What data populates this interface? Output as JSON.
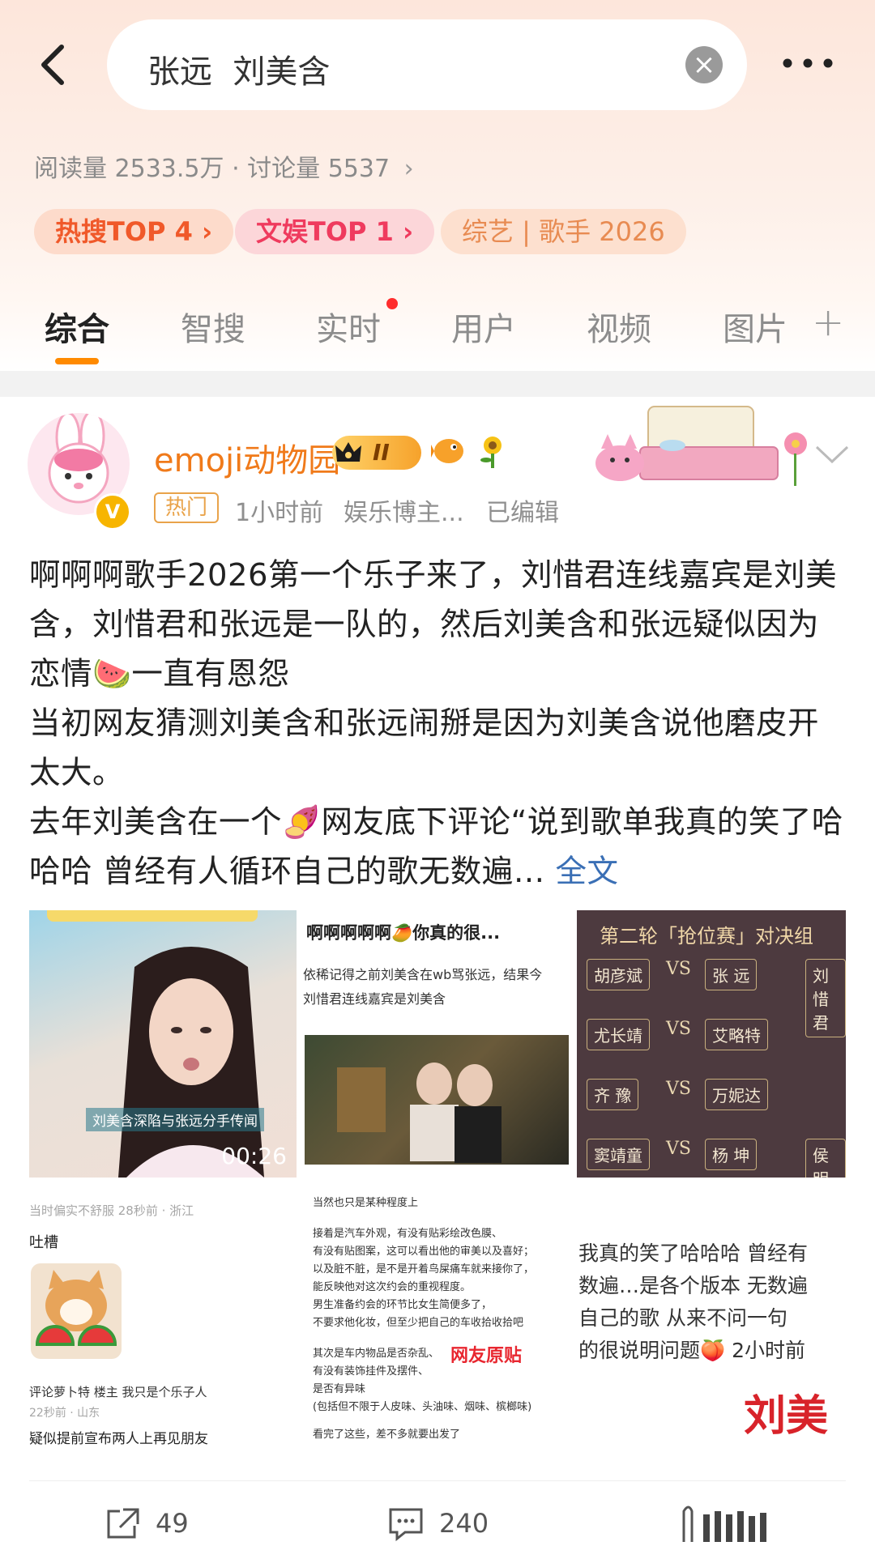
{
  "search": {
    "query": "张远  刘美含"
  },
  "stats": {
    "reads_label": "阅读量",
    "reads": "2533.5万",
    "dot": "·",
    "discuss_label": "讨论量",
    "discuss": "5537"
  },
  "tags": [
    {
      "label": "热搜TOP 4 ›"
    },
    {
      "label": "文娱TOP 1 ›"
    },
    {
      "label": "综艺  |  歌手 2026"
    }
  ],
  "tabs": [
    {
      "label": "综合"
    },
    {
      "label": "智搜"
    },
    {
      "label": "实时"
    },
    {
      "label": "用户"
    },
    {
      "label": "视频"
    },
    {
      "label": "图片"
    }
  ],
  "tab_plus": "+",
  "post": {
    "username": "emoji动物园",
    "vip_level": "II",
    "hot_label": "热门",
    "time": "1小时前",
    "source": "娱乐博主...",
    "edited": "已编辑",
    "paragraphs": [
      "啊啊啊歌手2026第一个乐子来了，刘惜君连线嘉宾是刘美含，刘惜君和张远是一队的，然后刘美含和张远疑似因为恋情🍉一直有恩怨",
      "当初网友猜测刘美含和张远闹掰是因为刘美含说他磨皮开太大。",
      "去年刘美含在一个🍠网友底下评论“说到歌单我真的笑了哈哈哈 曾经有人循环自己的歌无数遍…"
    ],
    "fulltext_label": "全文",
    "images": {
      "t1_caption": "刘美含深陷与张远分手传闻",
      "t1_duration": "00:26",
      "t2_title": "啊啊啊啊啊🥭你真的很...",
      "t2_line1": "依稀记得之前刘美含在wb骂张远，结果今",
      "t2_line2": "刘惜君连线嘉宾是刘美含",
      "t3_title": "第二轮「抢位赛」对决组",
      "t3_pairs": [
        [
          "胡彦斌",
          "VS",
          "张 远",
          "刘惜君"
        ],
        [
          "尤长靖",
          "VS",
          "艾略特",
          ""
        ],
        [
          "齐 豫",
          "VS",
          "万妮达",
          ""
        ],
        [
          "窦靖童",
          "VS",
          "杨 坤",
          "侯明昊"
        ]
      ],
      "t4_top": "当时偏实不舒服  28秒前 · 浙江",
      "t4_label": "吐槽",
      "t4_comment": "评论萝卜特 楼主  我只是个乐子人",
      "t4_time": "22秒前 · 山东",
      "t4_text": "疑似提前宣布两人上再见朋友",
      "t5_lines": [
        "当然也只是某种程度上",
        "接着是汽车外观，有没有贴彩绘改色膜、",
        "有没有贴图案，这可以看出他的审美以及喜好；",
        "以及脏不脏，是不是开着鸟屎痛车就来接你了，",
        "能反映他对这次约会的重视程度。",
        "男生准备约会的环节比女生简便多了，",
        "不要求他化妆，但至少把自己的车收拾收拾吧",
        "其次是车内物品是否杂乱、",
        "有没有装饰挂件及摆件、",
        "是否有异味",
        "(包括但不限于人皮味、头油味、烟味、槟榔味)",
        "看完了这些，差不多就要出发了"
      ],
      "t5_stamp": "网友原贴",
      "t6_lines": [
        "我真的笑了哈哈哈 曾经有",
        "数遍…是各个版本 无数遍",
        "自己的歌  从来不问一句",
        "的很说明问题🍑 2小时前"
      ],
      "t6_big": "刘美"
    }
  },
  "actions": {
    "share": "49",
    "comment": "240"
  }
}
